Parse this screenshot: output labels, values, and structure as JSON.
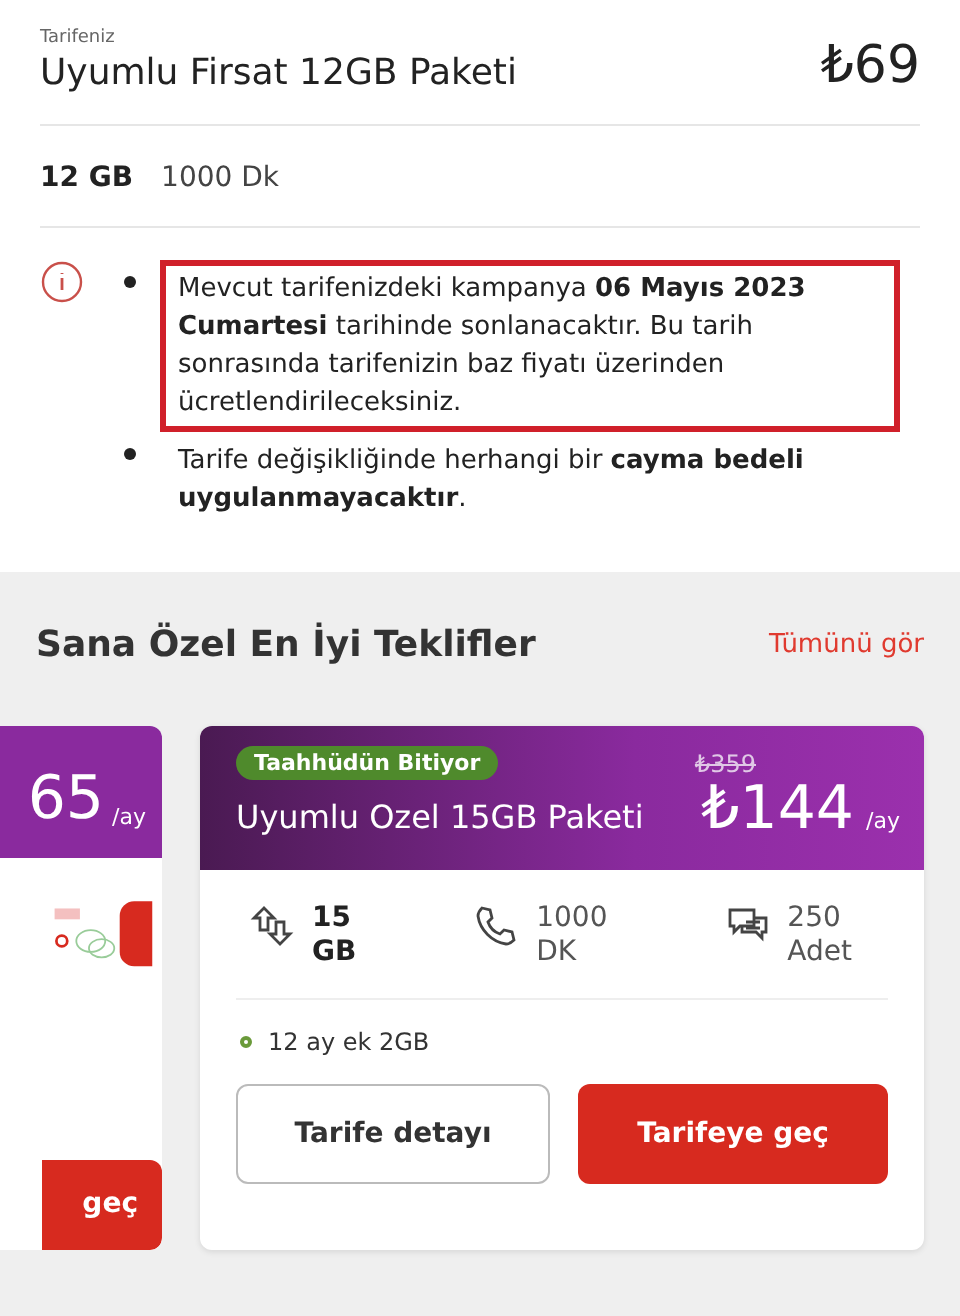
{
  "tariff": {
    "caption": "Tarifeniz",
    "name": "Uyumlu Firsat 12GB Paketi",
    "price": "₺69"
  },
  "allowances": [
    {
      "text": "12 GB",
      "bold": true
    },
    {
      "text": "1000 Dk",
      "bold": false
    }
  ],
  "notes": [
    {
      "text": "Mevcut tarifenizdeki kampanya **06 Mayıs 2023 Cumartesi** tarihinde sonlanacaktır. Bu tarih sonrasında tarifenizin baz fiyatı üzerinden ücretlendirileceksiniz.",
      "highlighted": true
    },
    {
      "text": "Tarife değişikliğinde herhangi bir **cayma bedeli uygulanmayacaktır**.",
      "highlighted": false
    }
  ],
  "offers_section": {
    "title": "Sana Özel En İyi Teklifler",
    "see_all": "Tümünü gör"
  },
  "offers": [
    {
      "kind": "partial",
      "price": "65",
      "unit": "/ay",
      "button": "geç"
    },
    {
      "kind": "full",
      "badge": "Taahhüdün Bitiyor",
      "old_price": "₺359",
      "name": "Uyumlu Ozel 15GB Paketi",
      "price": "₺144",
      "unit": "/ay",
      "features": [
        {
          "kind": "data",
          "value": "15",
          "unit": "GB"
        },
        {
          "kind": "call",
          "value": "1000",
          "unit": "DK"
        },
        {
          "kind": "sms",
          "value": "250",
          "unit": "Adet"
        }
      ],
      "extras": [
        "12 ay ek 2GB"
      ],
      "detail_button": "Tarife detayı",
      "button": "Tarifeye geç"
    }
  ]
}
